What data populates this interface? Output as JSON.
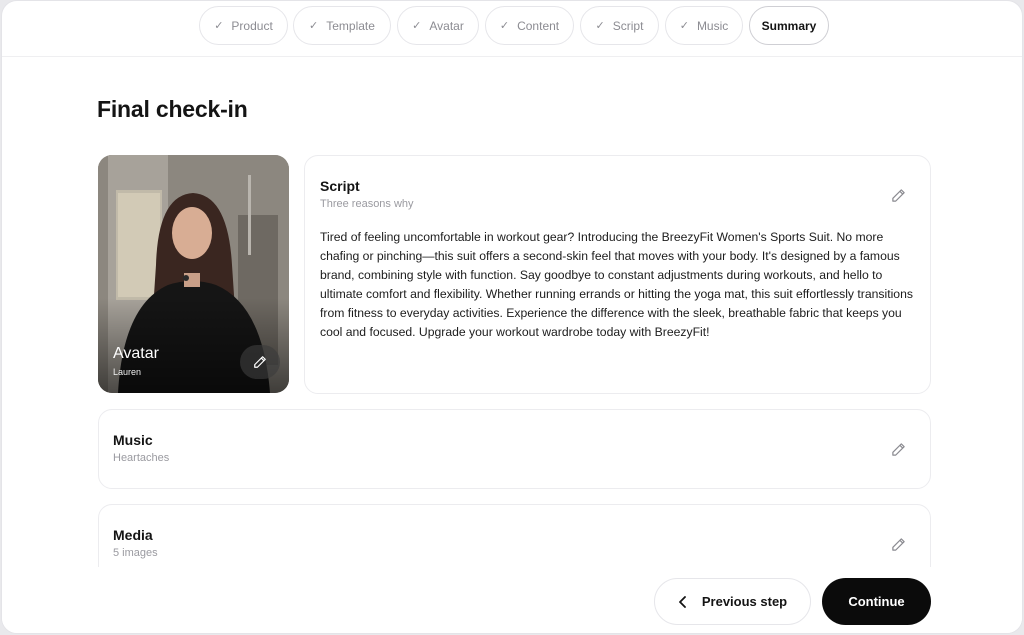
{
  "steps": [
    {
      "label": "Product",
      "done": true
    },
    {
      "label": "Template",
      "done": true
    },
    {
      "label": "Avatar",
      "done": true
    },
    {
      "label": "Content",
      "done": true
    },
    {
      "label": "Script",
      "done": true
    },
    {
      "label": "Music",
      "done": true
    },
    {
      "label": "Summary",
      "done": false,
      "active": true
    }
  ],
  "page": {
    "title": "Final check-in"
  },
  "avatar": {
    "title": "Avatar",
    "name": "Lauren"
  },
  "script": {
    "title": "Script",
    "subtitle": "Three reasons why",
    "body": "Tired of feeling uncomfortable in workout gear? Introducing the BreezyFit Women's Sports Suit. No more chafing or pinching—this suit offers a second-skin feel that moves with your body. It's designed by a famous brand, combining style with function. Say goodbye to constant adjustments during workouts, and hello to ultimate comfort and flexibility. Whether running errands or hitting the yoga mat, this suit effortlessly transitions from fitness to everyday activities. Experience the difference with the sleek, breathable fabric that keeps you cool and focused. Upgrade your workout wardrobe today with BreezyFit!"
  },
  "music": {
    "title": "Music",
    "subtitle": "Heartaches"
  },
  "media": {
    "title": "Media",
    "subtitle": "5 images"
  },
  "footer": {
    "previous_label": "Previous step",
    "continue_label": "Continue"
  },
  "icons": {
    "check": "check-icon",
    "edit": "pencil-icon",
    "back": "chevron-left-icon"
  },
  "colors": {
    "primary_button": "#0b0b0b",
    "muted_text": "#9a9aa0",
    "border": "#ececef"
  }
}
